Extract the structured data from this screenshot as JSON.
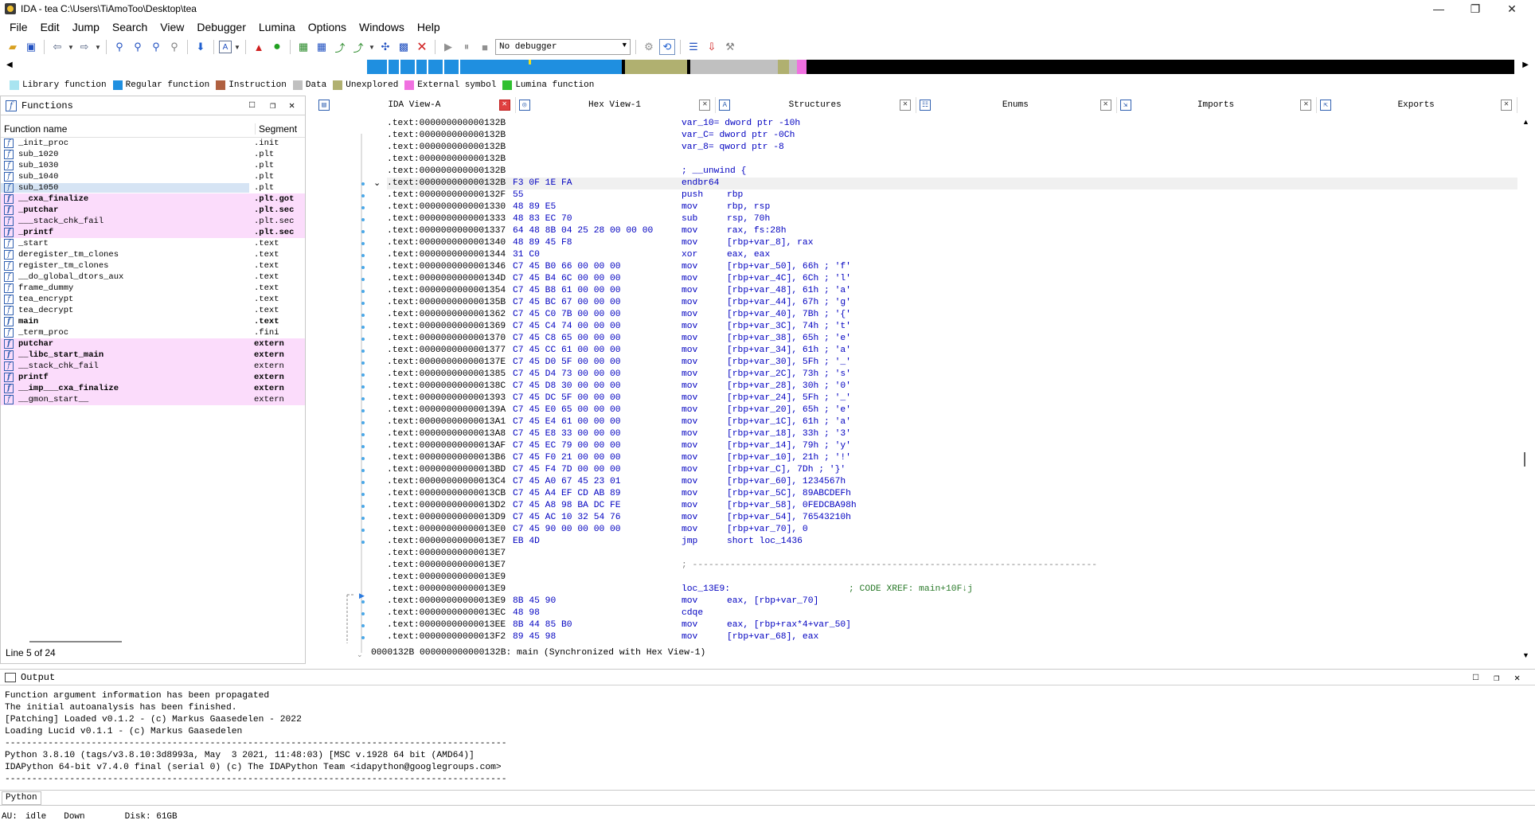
{
  "window": {
    "title": "IDA - tea C:\\Users\\TiAmoToo\\Desktop\\tea",
    "minimize": "—",
    "maximize": "❐",
    "close": "✕"
  },
  "menu": [
    "File",
    "Edit",
    "Jump",
    "Search",
    "View",
    "Debugger",
    "Lumina",
    "Options",
    "Windows",
    "Help"
  ],
  "toolbar": {
    "debugger_select": "No debugger"
  },
  "legend": [
    {
      "label": "Library function",
      "color": "#a8e4f0"
    },
    {
      "label": "Regular function",
      "color": "#1f8fe0"
    },
    {
      "label": "Instruction",
      "color": "#b06040"
    },
    {
      "label": "Data",
      "color": "#c0c0c0"
    },
    {
      "label": "Unexplored",
      "color": "#b0b070"
    },
    {
      "label": "External symbol",
      "color": "#f070e0"
    },
    {
      "label": "Lumina function",
      "color": "#30c030"
    }
  ],
  "functions_panel": {
    "title": "Functions",
    "col_name": "Function name",
    "col_segment": "Segment",
    "status": "Line 5 of 24",
    "rows": [
      {
        "name": "_init_proc",
        "segment": ".init",
        "style": ""
      },
      {
        "name": "sub_1020",
        "segment": ".plt",
        "style": ""
      },
      {
        "name": "sub_1030",
        "segment": ".plt",
        "style": ""
      },
      {
        "name": "sub_1040",
        "segment": ".plt",
        "style": ""
      },
      {
        "name": "sub_1050",
        "segment": ".plt",
        "style": "sel"
      },
      {
        "name": "__cxa_finalize",
        "segment": ".plt.got",
        "style": "pink bold"
      },
      {
        "name": "_putchar",
        "segment": ".plt.sec",
        "style": "pink bold"
      },
      {
        "name": "___stack_chk_fail",
        "segment": ".plt.sec",
        "style": "pink"
      },
      {
        "name": "_printf",
        "segment": ".plt.sec",
        "style": "pink bold"
      },
      {
        "name": "_start",
        "segment": ".text",
        "style": ""
      },
      {
        "name": "deregister_tm_clones",
        "segment": ".text",
        "style": ""
      },
      {
        "name": "register_tm_clones",
        "segment": ".text",
        "style": ""
      },
      {
        "name": "__do_global_dtors_aux",
        "segment": ".text",
        "style": ""
      },
      {
        "name": "frame_dummy",
        "segment": ".text",
        "style": ""
      },
      {
        "name": "tea_encrypt",
        "segment": ".text",
        "style": ""
      },
      {
        "name": "tea_decrypt",
        "segment": ".text",
        "style": ""
      },
      {
        "name": "main",
        "segment": ".text",
        "style": "bold"
      },
      {
        "name": "_term_proc",
        "segment": ".fini",
        "style": ""
      },
      {
        "name": "putchar",
        "segment": "extern",
        "style": "pink bold"
      },
      {
        "name": "__libc_start_main",
        "segment": "extern",
        "style": "pink bold"
      },
      {
        "name": "__stack_chk_fail",
        "segment": "extern",
        "style": "pink"
      },
      {
        "name": "printf",
        "segment": "extern",
        "style": "pink bold"
      },
      {
        "name": "__imp___cxa_finalize",
        "segment": "extern",
        "style": "pink bold"
      },
      {
        "name": "__gmon_start__",
        "segment": "extern",
        "style": "pink"
      }
    ]
  },
  "tabs": [
    {
      "label": "IDA View-A",
      "icon": "▤",
      "active": true
    },
    {
      "label": "Hex View-1",
      "icon": "◎",
      "active": false
    },
    {
      "label": "Structures",
      "icon": "A",
      "active": false
    },
    {
      "label": "Enums",
      "icon": "☷",
      "active": false
    },
    {
      "label": "Imports",
      "icon": "⇲",
      "active": false
    },
    {
      "label": "Exports",
      "icon": "⇱",
      "active": false
    }
  ],
  "disasm": [
    {
      "addr": ".text:000000000000132B",
      "bytes": "",
      "mn": "",
      "op": "",
      "txt": "var_10= dword ptr -10h"
    },
    {
      "addr": ".text:000000000000132B",
      "bytes": "",
      "mn": "",
      "op": "",
      "txt": "var_C= dword ptr -0Ch"
    },
    {
      "addr": ".text:000000000000132B",
      "bytes": "",
      "mn": "",
      "op": "",
      "txt": "var_8= qword ptr -8"
    },
    {
      "addr": ".text:000000000000132B",
      "bytes": "",
      "mn": "",
      "op": "",
      "txt": ""
    },
    {
      "addr": ".text:000000000000132B",
      "bytes": "",
      "mn": "",
      "op": "",
      "txt": "; __unwind {"
    },
    {
      "addr": ".text:000000000000132B",
      "bytes": "F3 0F 1E FA",
      "mn": "endbr64",
      "op": "",
      "txt": "",
      "hl": true
    },
    {
      "addr": ".text:000000000000132F",
      "bytes": "55",
      "mn": "push",
      "op": "rbp",
      "txt": ""
    },
    {
      "addr": ".text:0000000000001330",
      "bytes": "48 89 E5",
      "mn": "mov",
      "op": "rbp, rsp",
      "txt": ""
    },
    {
      "addr": ".text:0000000000001333",
      "bytes": "48 83 EC 70",
      "mn": "sub",
      "op": "rsp, 70h",
      "txt": ""
    },
    {
      "addr": ".text:0000000000001337",
      "bytes": "64 48 8B 04 25 28 00 00 00",
      "mn": "mov",
      "op": "rax, fs:28h",
      "txt": ""
    },
    {
      "addr": ".text:0000000000001340",
      "bytes": "48 89 45 F8",
      "mn": "mov",
      "op": "[rbp+var_8], rax",
      "txt": ""
    },
    {
      "addr": ".text:0000000000001344",
      "bytes": "31 C0",
      "mn": "xor",
      "op": "eax, eax",
      "txt": ""
    },
    {
      "addr": ".text:0000000000001346",
      "bytes": "C7 45 B0 66 00 00 00",
      "mn": "mov",
      "op": "[rbp+var_50], 66h ; 'f'",
      "txt": ""
    },
    {
      "addr": ".text:000000000000134D",
      "bytes": "C7 45 B4 6C 00 00 00",
      "mn": "mov",
      "op": "[rbp+var_4C], 6Ch ; 'l'",
      "txt": ""
    },
    {
      "addr": ".text:0000000000001354",
      "bytes": "C7 45 B8 61 00 00 00",
      "mn": "mov",
      "op": "[rbp+var_48], 61h ; 'a'",
      "txt": ""
    },
    {
      "addr": ".text:000000000000135B",
      "bytes": "C7 45 BC 67 00 00 00",
      "mn": "mov",
      "op": "[rbp+var_44], 67h ; 'g'",
      "txt": ""
    },
    {
      "addr": ".text:0000000000001362",
      "bytes": "C7 45 C0 7B 00 00 00",
      "mn": "mov",
      "op": "[rbp+var_40], 7Bh ; '{'",
      "txt": ""
    },
    {
      "addr": ".text:0000000000001369",
      "bytes": "C7 45 C4 74 00 00 00",
      "mn": "mov",
      "op": "[rbp+var_3C], 74h ; 't'",
      "txt": ""
    },
    {
      "addr": ".text:0000000000001370",
      "bytes": "C7 45 C8 65 00 00 00",
      "mn": "mov",
      "op": "[rbp+var_38], 65h ; 'e'",
      "txt": ""
    },
    {
      "addr": ".text:0000000000001377",
      "bytes": "C7 45 CC 61 00 00 00",
      "mn": "mov",
      "op": "[rbp+var_34], 61h ; 'a'",
      "txt": ""
    },
    {
      "addr": ".text:000000000000137E",
      "bytes": "C7 45 D0 5F 00 00 00",
      "mn": "mov",
      "op": "[rbp+var_30], 5Fh ; '_'",
      "txt": ""
    },
    {
      "addr": ".text:0000000000001385",
      "bytes": "C7 45 D4 73 00 00 00",
      "mn": "mov",
      "op": "[rbp+var_2C], 73h ; 's'",
      "txt": ""
    },
    {
      "addr": ".text:000000000000138C",
      "bytes": "C7 45 D8 30 00 00 00",
      "mn": "mov",
      "op": "[rbp+var_28], 30h ; '0'",
      "txt": ""
    },
    {
      "addr": ".text:0000000000001393",
      "bytes": "C7 45 DC 5F 00 00 00",
      "mn": "mov",
      "op": "[rbp+var_24], 5Fh ; '_'",
      "txt": ""
    },
    {
      "addr": ".text:000000000000139A",
      "bytes": "C7 45 E0 65 00 00 00",
      "mn": "mov",
      "op": "[rbp+var_20], 65h ; 'e'",
      "txt": ""
    },
    {
      "addr": ".text:00000000000013A1",
      "bytes": "C7 45 E4 61 00 00 00",
      "mn": "mov",
      "op": "[rbp+var_1C], 61h ; 'a'",
      "txt": ""
    },
    {
      "addr": ".text:00000000000013A8",
      "bytes": "C7 45 E8 33 00 00 00",
      "mn": "mov",
      "op": "[rbp+var_18], 33h ; '3'",
      "txt": ""
    },
    {
      "addr": ".text:00000000000013AF",
      "bytes": "C7 45 EC 79 00 00 00",
      "mn": "mov",
      "op": "[rbp+var_14], 79h ; 'y'",
      "txt": ""
    },
    {
      "addr": ".text:00000000000013B6",
      "bytes": "C7 45 F0 21 00 00 00",
      "mn": "mov",
      "op": "[rbp+var_10], 21h ; '!'",
      "txt": ""
    },
    {
      "addr": ".text:00000000000013BD",
      "bytes": "C7 45 F4 7D 00 00 00",
      "mn": "mov",
      "op": "[rbp+var_C], 7Dh ; '}'",
      "txt": ""
    },
    {
      "addr": ".text:00000000000013C4",
      "bytes": "C7 45 A0 67 45 23 01",
      "mn": "mov",
      "op": "[rbp+var_60], 1234567h",
      "txt": ""
    },
    {
      "addr": ".text:00000000000013CB",
      "bytes": "C7 45 A4 EF CD AB 89",
      "mn": "mov",
      "op": "[rbp+var_5C], 89ABCDEFh",
      "txt": ""
    },
    {
      "addr": ".text:00000000000013D2",
      "bytes": "C7 45 A8 98 BA DC FE",
      "mn": "mov",
      "op": "[rbp+var_58], 0FEDCBA98h",
      "txt": ""
    },
    {
      "addr": ".text:00000000000013D9",
      "bytes": "C7 45 AC 10 32 54 76",
      "mn": "mov",
      "op": "[rbp+var_54], 76543210h",
      "txt": ""
    },
    {
      "addr": ".text:00000000000013E0",
      "bytes": "C7 45 90 00 00 00 00",
      "mn": "mov",
      "op": "[rbp+var_70], 0",
      "txt": ""
    },
    {
      "addr": ".text:00000000000013E7",
      "bytes": "EB 4D",
      "mn": "jmp",
      "op": "short loc_1436",
      "txt": ""
    },
    {
      "addr": ".text:00000000000013E7",
      "bytes": "",
      "mn": "",
      "op": "",
      "txt": ""
    },
    {
      "addr": ".text:00000000000013E7",
      "bytes": "",
      "mn": "",
      "op": "",
      "txt": "",
      "sep": "; ---------------------------------------------------------------------------"
    },
    {
      "addr": ".text:00000000000013E9",
      "bytes": "",
      "mn": "",
      "op": "",
      "txt": ""
    },
    {
      "addr": ".text:00000000000013E9",
      "bytes": "",
      "mn": "",
      "op": "",
      "txt": "loc_13E9:",
      "xref": "; CODE XREF: main+10F↓j"
    },
    {
      "addr": ".text:00000000000013E9",
      "bytes": "8B 45 90",
      "mn": "mov",
      "op": "eax, [rbp+var_70]",
      "txt": ""
    },
    {
      "addr": ".text:00000000000013EC",
      "bytes": "48 98",
      "mn": "cdqe",
      "op": "",
      "txt": ""
    },
    {
      "addr": ".text:00000000000013EE",
      "bytes": "8B 44 85 B0",
      "mn": "mov",
      "op": "eax, [rbp+rax*4+var_50]",
      "txt": ""
    },
    {
      "addr": ".text:00000000000013F2",
      "bytes": "89 45 98",
      "mn": "mov",
      "op": "[rbp+var_68], eax",
      "txt": ""
    }
  ],
  "disasm_status": "0000132B 000000000000132B: main (Synchronized with Hex View-1)",
  "output": {
    "title": "Output",
    "lines": [
      "Function argument information has been propagated",
      "The initial autoanalysis has been finished.",
      "[Patching] Loaded v0.1.2 - (c) Markus Gaasedelen - 2022",
      "Loading Lucid v0.1.1 - (c) Markus Gaasedelen",
      "---------------------------------------------------------------------------------------------",
      "Python 3.8.10 (tags/v3.8.10:3d8993a, May  3 2021, 11:48:03) [MSC v.1928 64 bit (AMD64)]",
      "IDAPython 64-bit v7.4.0 final (serial 0) (c) The IDAPython Team <idapython@googlegroups.com>",
      "---------------------------------------------------------------------------------------------"
    ]
  },
  "python_button": "Python",
  "status": {
    "au_label": "AU:",
    "au_state": "idle",
    "direction": "Down",
    "disk": "Disk: 61GB"
  }
}
